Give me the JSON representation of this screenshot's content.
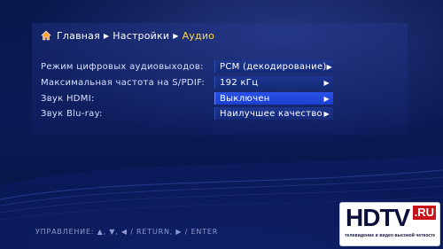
{
  "breadcrumb": {
    "items": [
      "Главная",
      "Настройки",
      "Аудио"
    ]
  },
  "settings": [
    {
      "label": "Режим цифровых аудиовыходов:",
      "value": "PCM (декодирование)",
      "selected": false
    },
    {
      "label": "Максимальная частота на S/PDIF:",
      "value": "192 кГц",
      "selected": false
    },
    {
      "label": "Звук HDMI:",
      "value": "Выключен",
      "selected": true
    },
    {
      "label": "Звук Blu-ray:",
      "value": "Наилучшее качество",
      "selected": false
    }
  ],
  "footer": {
    "hint": "УПРАВЛЕНИЕ:  ▲, ▼, ◀ / RETURN, ▶ / ENTER"
  },
  "watermark": {
    "main": "HDTV",
    "suffix": ".RU",
    "tagline": "телевидение и видео высокой четкости"
  },
  "colors": {
    "accent_current_crumb": "#ffd84a",
    "selected_row": "#2a52e6",
    "row_value_bg": "#1e3590",
    "background": "#08164a"
  }
}
